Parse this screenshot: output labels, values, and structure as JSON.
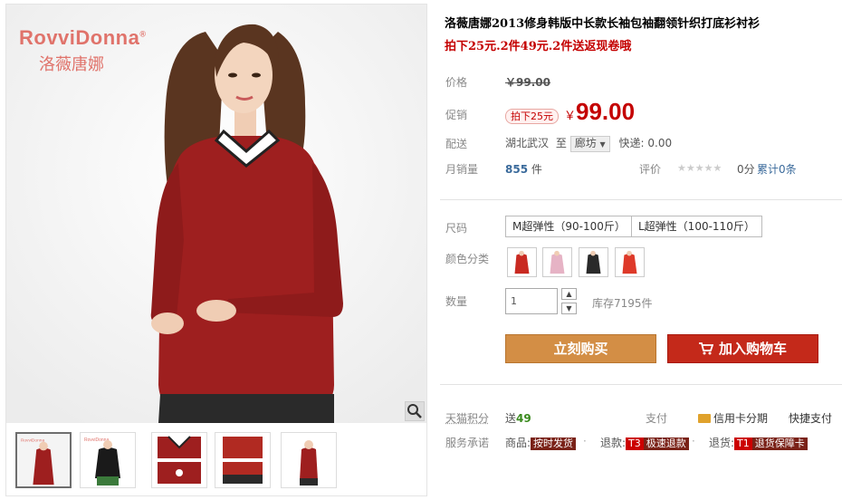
{
  "brand": {
    "name_en": "RovviDonna",
    "reg": "®",
    "name_cn": "洛薇唐娜"
  },
  "product": {
    "title": "洛薇唐娜2013修身韩版中长款长袖包袖翻领针织打底衫衬衫",
    "promo": "拍下25元.2件49元.2件送返现卷哦"
  },
  "price": {
    "label": "价格",
    "original": "￥99.00",
    "promo_label": "促销",
    "promo_tag": "拍下25元",
    "currency": "￥",
    "promo_price": "99.00"
  },
  "shipping": {
    "label": "配送",
    "from": "湖北武汉",
    "to_word": "至",
    "to_city": "廊坊",
    "fee": "快递: 0.00"
  },
  "sales": {
    "label": "月销量",
    "count": "855",
    "unit": "件",
    "rating_label": "评价",
    "stars": "★★★★★",
    "score": "0分",
    "total": "累计0条"
  },
  "size": {
    "label": "尺码",
    "options": [
      "M超弹性（90-100斤）",
      "L超弹性（100-110斤）"
    ]
  },
  "color": {
    "label": "颜色分类",
    "swatches": [
      "#c92a22",
      "#e6b3c5",
      "#2a2a2a",
      "#de3a2a"
    ]
  },
  "quantity": {
    "label": "数量",
    "value": "1",
    "stock": "库存7195件"
  },
  "buttons": {
    "buy": "立刻购买",
    "cart": "加入购物车"
  },
  "service": {
    "points_label": "天猫积分",
    "points_text": "送",
    "points_value": "49",
    "pay_label": "支付",
    "credit": "信用卡分期",
    "quick": "快捷支付",
    "promise_label": "服务承诺",
    "goods_label": "商品:",
    "goods_badge": "按时发货",
    "refund_label": "退款:",
    "refund_code": "T3",
    "refund_badge": "极速退款",
    "return_label": "退货:",
    "return_code": "T1",
    "return_badge": "退货保障卡"
  },
  "gallery": {
    "thumb_count": 5
  }
}
